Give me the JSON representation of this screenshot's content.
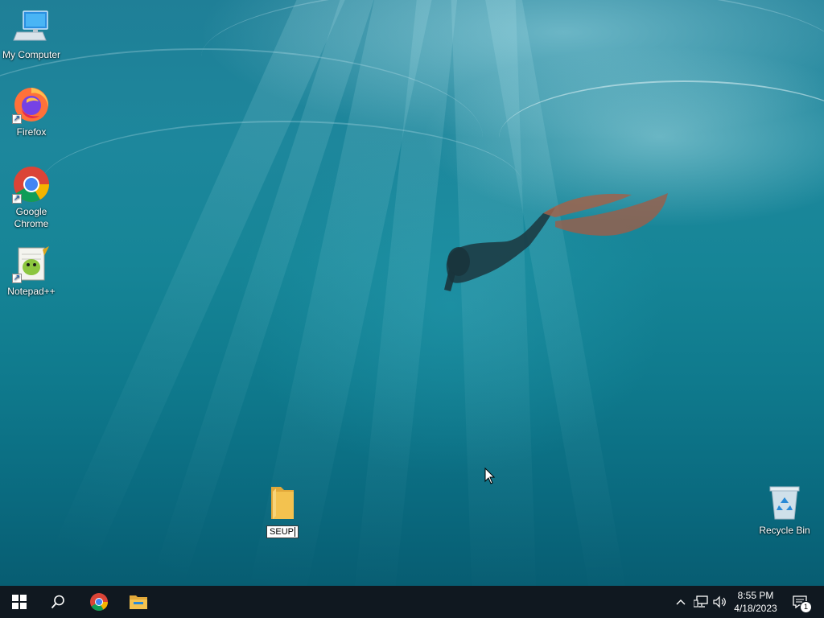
{
  "desktop": {
    "icons": [
      {
        "name": "my-computer",
        "label": "My Computer",
        "icon": "monitor-icon"
      },
      {
        "name": "firefox",
        "label": "Firefox",
        "icon": "firefox-icon",
        "shortcut": true
      },
      {
        "name": "google-chrome",
        "label": "Google Chrome",
        "icon": "chrome-icon",
        "shortcut": true
      },
      {
        "name": "notepad-plus-plus",
        "label": "Notepad++",
        "icon": "notepadpp-icon",
        "shortcut": true
      },
      {
        "name": "new-folder",
        "label": "SEUP",
        "icon": "folder-icon",
        "renaming": true
      },
      {
        "name": "recycle-bin",
        "label": "Recycle Bin",
        "icon": "recycle-bin-icon"
      }
    ]
  },
  "taskbar": {
    "start": {
      "icon": "windows-logo-icon"
    },
    "search": {
      "icon": "search-icon"
    },
    "pinned": [
      {
        "name": "chrome",
        "icon": "chrome-icon"
      },
      {
        "name": "file-explorer",
        "icon": "folder-icon"
      }
    ],
    "tray": {
      "icons": [
        "chevron-up-icon",
        "network-icon",
        "volume-icon"
      ],
      "time": "8:55 PM",
      "date": "4/18/2023",
      "notification_count": "1",
      "notification_icon": "action-center-icon"
    }
  },
  "colors": {
    "taskbar": "#101820",
    "folder": "#f3c24f",
    "chrome_red": "#db4437",
    "chrome_yellow": "#f4b400",
    "chrome_green": "#0f9d58",
    "chrome_blue": "#4285f4"
  }
}
